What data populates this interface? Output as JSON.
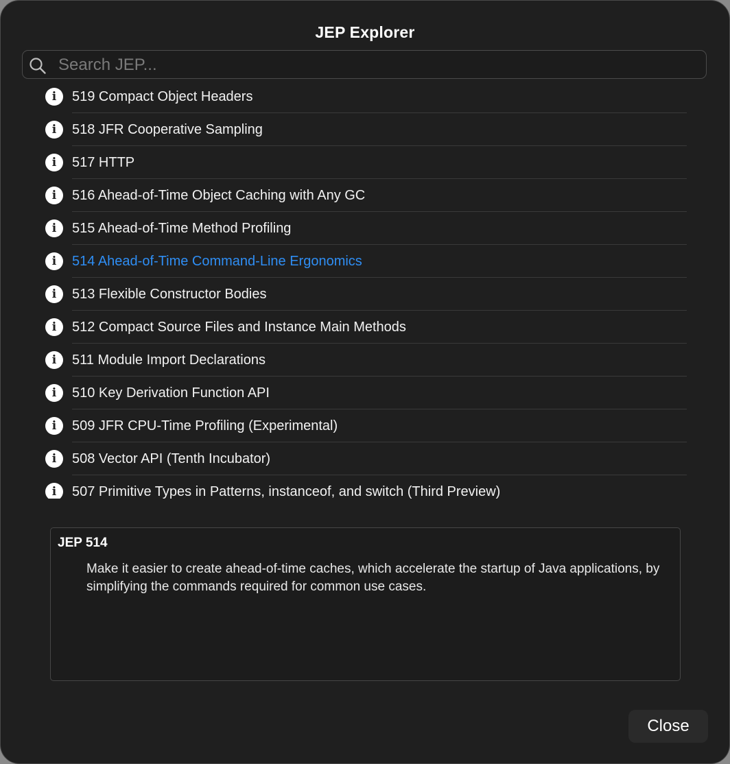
{
  "window": {
    "title": "JEP Explorer"
  },
  "search": {
    "placeholder": "Search JEP...",
    "value": ""
  },
  "list": {
    "selected_index": 5,
    "items": [
      {
        "label": "519 Compact Object Headers"
      },
      {
        "label": "518 JFR Cooperative Sampling"
      },
      {
        "label": "517 HTTP"
      },
      {
        "label": "516 Ahead-of-Time Object Caching with Any GC"
      },
      {
        "label": "515 Ahead-of-Time Method Profiling"
      },
      {
        "label": "514 Ahead-of-Time Command-Line Ergonomics"
      },
      {
        "label": "513 Flexible Constructor Bodies"
      },
      {
        "label": "512 Compact Source Files and Instance Main Methods"
      },
      {
        "label": "511 Module Import Declarations"
      },
      {
        "label": "510 Key Derivation Function API"
      },
      {
        "label": "509 JFR CPU-Time Profiling (Experimental)"
      },
      {
        "label": "508 Vector API (Tenth Incubator)"
      },
      {
        "label": "507 Primitive Types in Patterns, instanceof, and switch (Third Preview)"
      }
    ],
    "item_icon": "info-icon",
    "item_icon_glyph": "i"
  },
  "details": {
    "title": "JEP 514",
    "description": "Make it easier to create ahead-of-time caches, which accelerate the startup of Java applications, by simplifying the commands required for common use cases."
  },
  "footer": {
    "close_label": "Close"
  },
  "colors": {
    "window_bg": "#1f1f1f",
    "selected_text": "#2f8ef4",
    "text": "#f2f2f2"
  }
}
